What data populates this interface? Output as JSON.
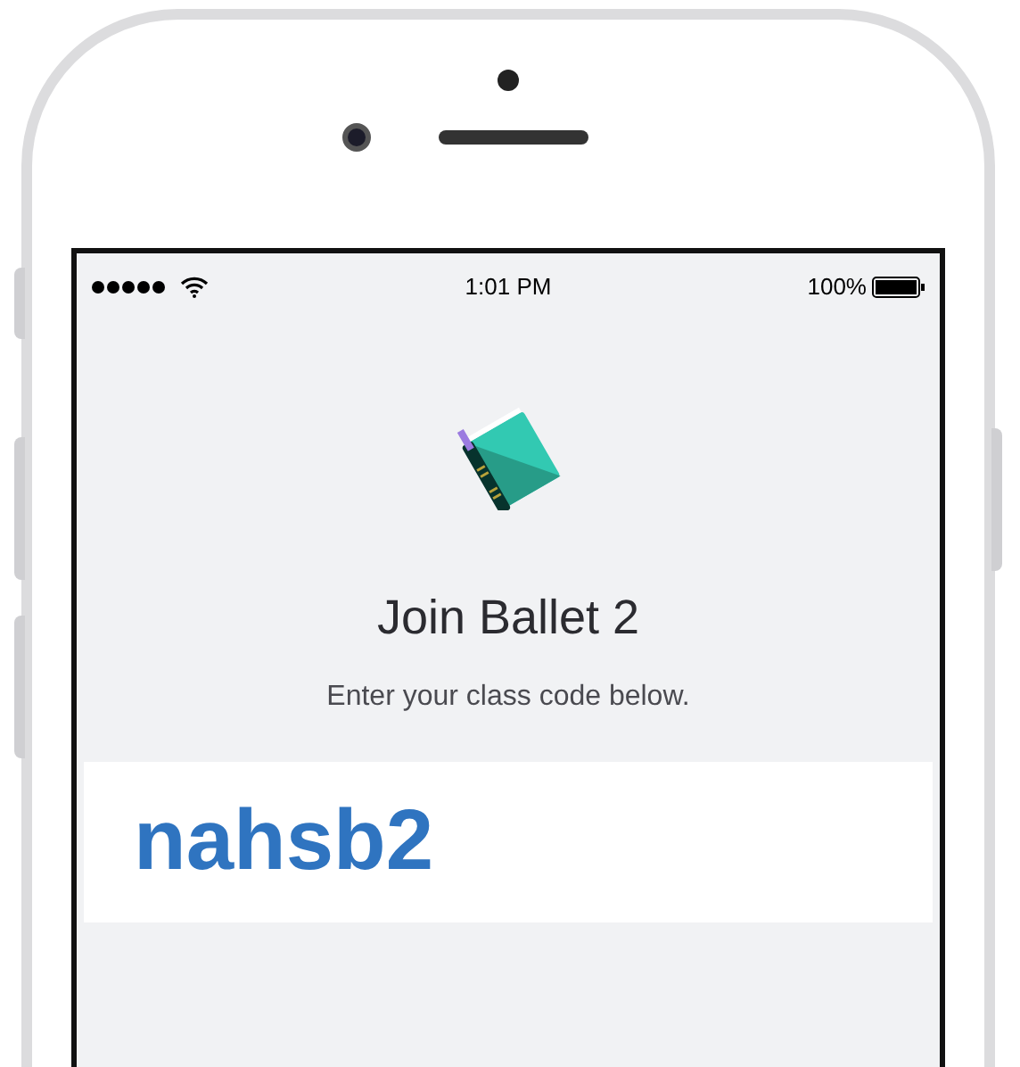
{
  "status_bar": {
    "time": "1:01 PM",
    "battery": "100%"
  },
  "title": "Join Ballet 2",
  "subtitle": "Enter your class code below.",
  "code_field": {
    "value": "nahsb2"
  }
}
